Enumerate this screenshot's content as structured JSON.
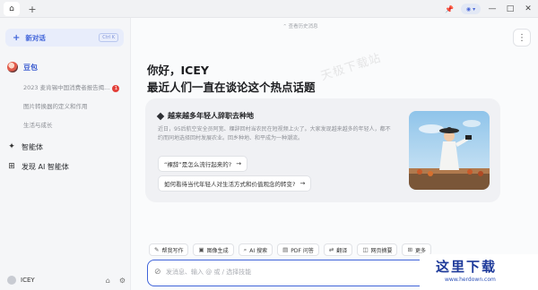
{
  "tabs": {
    "home_icon": "home-icon",
    "add_icon": "plus-icon"
  },
  "window": {
    "pin_icon": "pin-icon",
    "minimize": "—",
    "maximize": "□",
    "close": "✕"
  },
  "sidebar": {
    "new_chat_label": "新对话",
    "new_chat_shortcut": "Ctrl K",
    "bot_name": "豆包",
    "conversations": [
      {
        "title": "2023 麦肯锡中国消费者报告揭...",
        "badge": "1"
      },
      {
        "title": "图片转换器的定义和作用"
      },
      {
        "title": "生活与成长"
      }
    ],
    "items": [
      {
        "label": "智能体",
        "icon": "agent-icon"
      },
      {
        "label": "发现 AI 智能体",
        "icon": "discover-icon"
      }
    ],
    "user_name": "ICEY"
  },
  "main": {
    "history_hint": "查看历史消息",
    "greeting": "你好，ICEY",
    "subtitle": "最近人们一直在谈论这个热点话题",
    "watermark": "天极下载站",
    "card": {
      "title": "越来越多年轻人辞职去种地",
      "description": "近日，95后航空安全员阿宽、稞辞回村当农民在短视频上火了。大家发现越来越多的年轻人，都不约而同地选择回村发展农业。回乡种地、和平成为一种潮流。",
      "questions": [
        "“裸辞”是怎么流行起来的?",
        "如何看待当代年轻人对生活方式和价值观念的转变?"
      ]
    },
    "tools": [
      {
        "label": "帮我写作",
        "icon": "write-icon"
      },
      {
        "label": "图像生成",
        "icon": "image-icon"
      },
      {
        "label": "AI 搜索",
        "icon": "search-icon"
      },
      {
        "label": "PDF 问答",
        "icon": "pdf-icon"
      },
      {
        "label": "翻译",
        "icon": "translate-icon"
      },
      {
        "label": "网页摘要",
        "icon": "web-icon"
      },
      {
        "label": "更多",
        "icon": "more-icon"
      }
    ],
    "input_placeholder": "发消息、输入 @ 或 / 选择技能"
  },
  "site_logo": {
    "text": "这里下载",
    "url": "www.herdown.com"
  }
}
